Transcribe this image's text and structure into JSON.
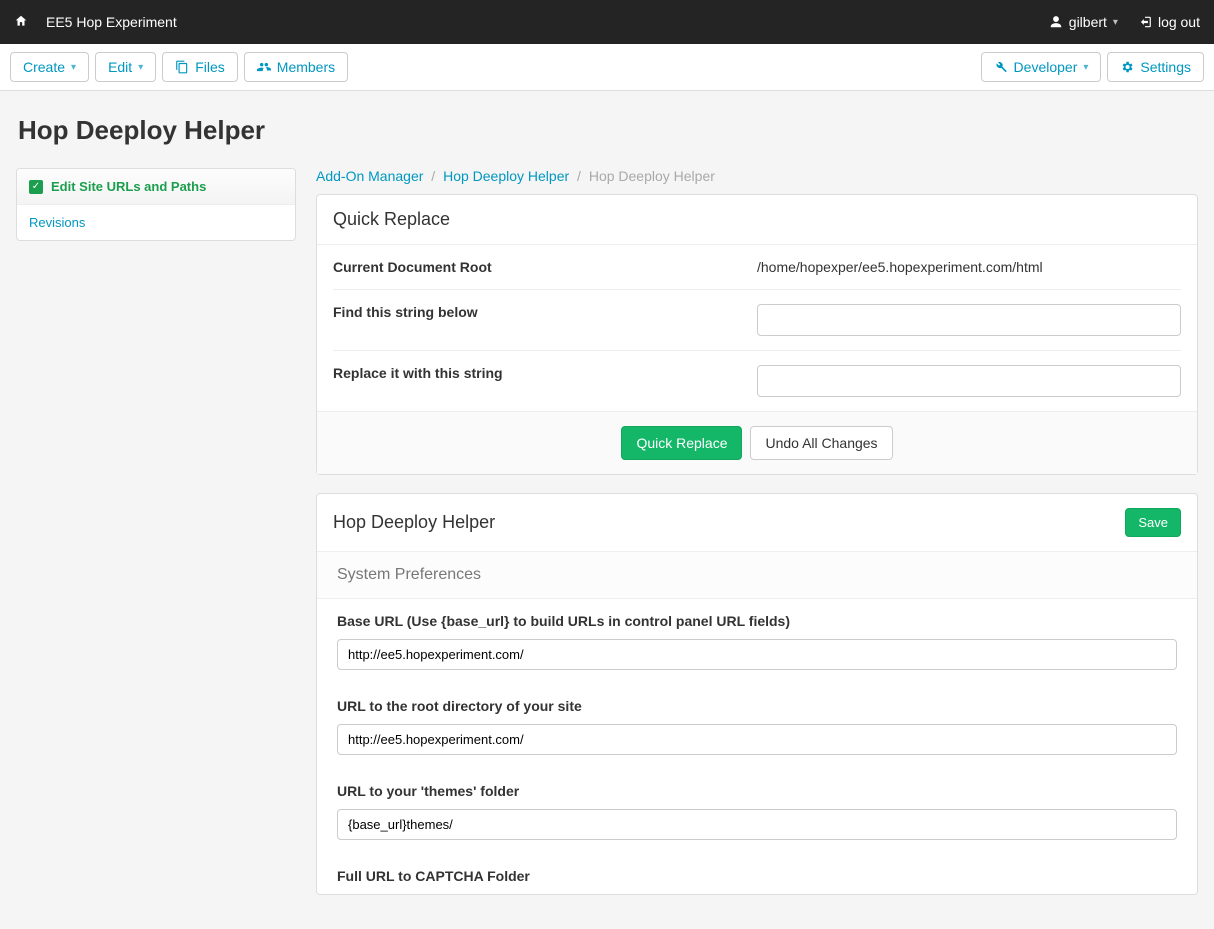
{
  "topbar": {
    "site_name": "EE5 Hop Experiment",
    "user": "gilbert",
    "logout": "log out"
  },
  "toolbar": {
    "create": "Create",
    "edit": "Edit",
    "files": "Files",
    "members": "Members",
    "developer": "Developer",
    "settings": "Settings"
  },
  "page_title": "Hop Deeploy Helper",
  "sidebar": {
    "items": [
      {
        "label": "Edit Site URLs and Paths",
        "active": true
      },
      {
        "label": "Revisions",
        "active": false
      }
    ]
  },
  "breadcrumb": {
    "items": [
      "Add-On Manager",
      "Hop Deeploy Helper"
    ],
    "current": "Hop Deeploy Helper"
  },
  "quick_replace": {
    "title": "Quick Replace",
    "doc_root_label": "Current Document Root",
    "doc_root_value": "/home/hopexper/ee5.hopexperiment.com/html",
    "find_label": "Find this string below",
    "find_value": "",
    "replace_label": "Replace it with this string",
    "replace_value": "",
    "btn_replace": "Quick Replace",
    "btn_undo": "Undo All Changes"
  },
  "helper_panel": {
    "title": "Hop Deeploy Helper",
    "save": "Save",
    "section": "System Preferences",
    "fields": {
      "base_url_label": "Base URL (Use {base_url} to build URLs in control panel URL fields)",
      "base_url_value": "http://ee5.hopexperiment.com/",
      "site_url_label": "URL to the root directory of your site",
      "site_url_value": "http://ee5.hopexperiment.com/",
      "themes_label": "URL to your 'themes' folder",
      "themes_value": "{base_url}themes/",
      "captcha_label": "Full URL to CAPTCHA Folder"
    }
  }
}
